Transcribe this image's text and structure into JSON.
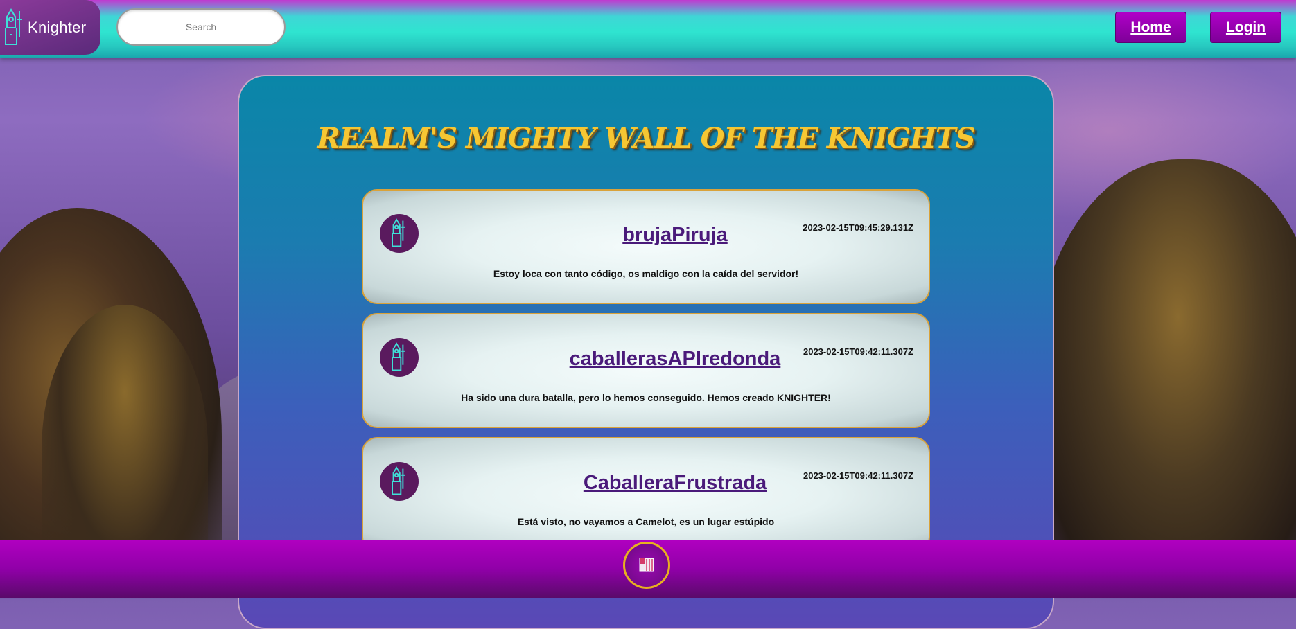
{
  "header": {
    "logo_text": "Knighter",
    "search_placeholder": "Search",
    "nav": {
      "home_label": "Home",
      "login_label": "Login"
    }
  },
  "main": {
    "title": "REALM'S MIGHTY WALL OF THE KNIGHTS",
    "posts": [
      {
        "username": "brujaPiruja",
        "date": "2023-02-15T09:45:29.131Z",
        "message": "Estoy loca con tanto código, os maldigo con la caída del servidor!"
      },
      {
        "username": "caballerasAPIredonda",
        "date": "2023-02-15T09:42:11.307Z",
        "message": "Ha sido una dura batalla, pero lo hemos conseguido. Hemos creado KNIGHTER!"
      },
      {
        "username": "CaballeraFrustrada",
        "date": "2023-02-15T09:42:11.307Z",
        "message": "Está visto, no vayamos a Camelot, es un lugar estúpido"
      }
    ]
  },
  "colors": {
    "accent_purple": "#b000c8",
    "title_gold": "#f6c733",
    "username_purple": "#4a1a7a",
    "panel_teal": "#0a86a8"
  },
  "icons": {
    "logo": "knight-icon",
    "avatar": "knight-icon",
    "footer": "shield-badge-icon"
  }
}
